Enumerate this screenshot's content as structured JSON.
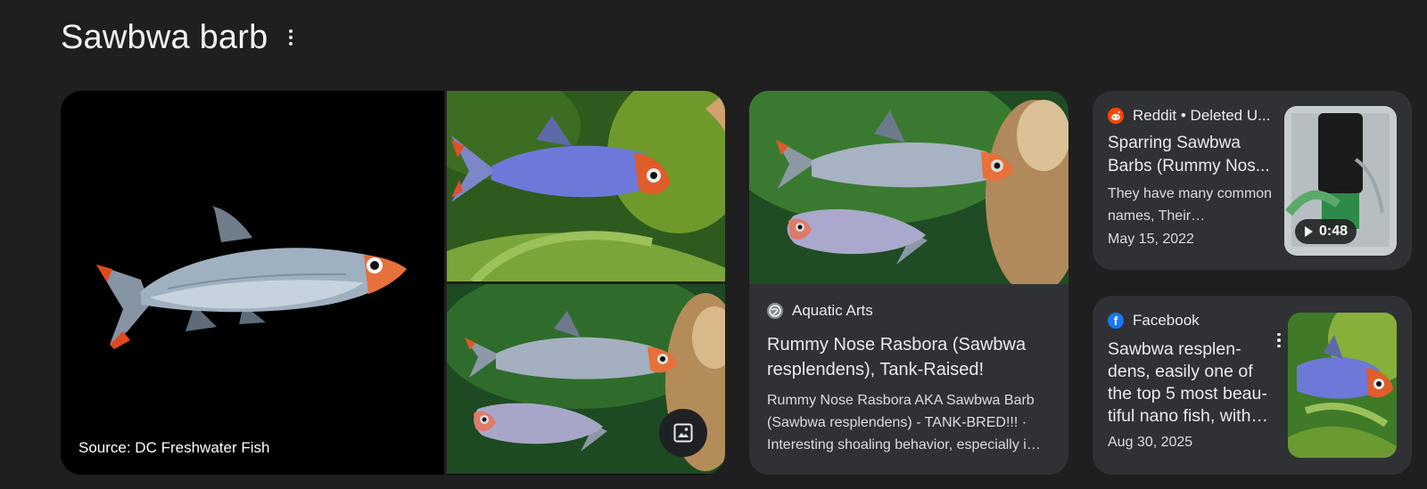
{
  "page": {
    "title": "Sawbwa barb"
  },
  "image_collage": {
    "source_label": "Source: DC Freshwater Fish",
    "images": [
      {
        "name": "Main silver fish on black background"
      },
      {
        "name": "Blue Sawbwa barb among green leaves"
      },
      {
        "name": "Rummy nose rasboras in tank"
      }
    ]
  },
  "cards": {
    "aquatic": {
      "site": "Aquatic Arts",
      "title": "Rummy Nose Rasbora (Sawbwa resplendens), Tank-Raised!",
      "snippet": "Rummy Nose Rasbora AKA Sawbwa Barb (Sawbwa resplendens) - TANK-BRED!!! · Interesting shoaling behavior, especially i…"
    },
    "reddit": {
      "site": "Reddit • Deleted U...",
      "title": "Sparring Sawbwa Barbs (Rummy Nos...",
      "snippet": "They have many common names, Their…",
      "date": "May 15, 2022",
      "duration": "0:48"
    },
    "facebook": {
      "site": "Facebook",
      "title": "Sawbwa resplen-dens, easily one of the top 5 most beau-tiful nano fish, with…",
      "date": "Aug 30, 2025"
    }
  },
  "colors": {
    "background": "#1f1f1f",
    "card": "#303134",
    "reddit": "#ff4500",
    "facebook": "#1877f2"
  }
}
